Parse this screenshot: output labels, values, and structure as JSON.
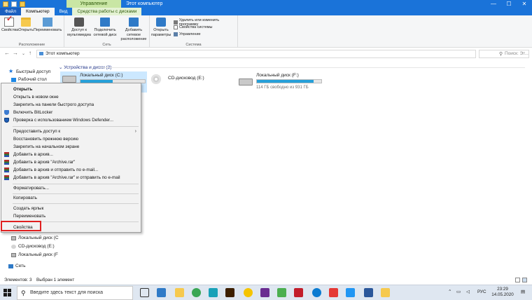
{
  "window": {
    "title": "Этот компьютер",
    "ribbon_context_header": "Управление",
    "controls": [
      "—",
      "☐",
      "✕"
    ]
  },
  "tabs": [
    {
      "label": "Файл"
    },
    {
      "label": "Компьютер"
    },
    {
      "label": "Вид"
    },
    {
      "label": "Средства работы с дисками"
    }
  ],
  "ribbon": {
    "groups": [
      {
        "label": "Расположение",
        "buttons": [
          "Свойства",
          "Открыть",
          "Переименовать"
        ]
      },
      {
        "label": "Сеть",
        "buttons": [
          "Доступ к мультимедиа",
          "Подключить сетевой диск",
          "Добавить сетевое расположение"
        ]
      },
      {
        "label": "Система",
        "buttons": [
          "Открыть параметры"
        ],
        "small_items": [
          "Удалить или изменить программу",
          "Свойства системы",
          "Управление"
        ]
      }
    ]
  },
  "address": {
    "path": "Этот компьютер",
    "search_placeholder": "Поиск: Эт..."
  },
  "nav": {
    "items": [
      "Быстрый доступ",
      "Рабочий стол",
      "Локальный диск (C",
      "CD-дисковод (E:)",
      "Локальный диск (F",
      "Сеть"
    ]
  },
  "content": {
    "group_header": "Устройства и диски (3)",
    "drives": [
      {
        "name": "Локальный диск (C:)",
        "free": "",
        "fill": 0.5
      },
      {
        "name": "CD-дисковод (E:)",
        "free": "",
        "fill": 0
      },
      {
        "name": "Локальный диск (F:)",
        "free": "114 ГБ свободно из 931 ГБ",
        "fill": 0.88
      }
    ]
  },
  "context_menu": {
    "items": [
      {
        "label": "Открыть",
        "bold": true
      },
      {
        "label": "Открыть в новом окне"
      },
      {
        "label": "Закрепить на панели быстрого доступа"
      },
      {
        "label": "Включить BitLocker",
        "icon": "shield-icon"
      },
      {
        "label": "Проверка с использованием Windows Defender...",
        "icon": "defender-icon"
      },
      {
        "label": "Предоставить доступ к",
        "submenu": true
      },
      {
        "label": "Восстановить прежнюю версию"
      },
      {
        "label": "Закрепить на начальном экране"
      },
      {
        "label": "Добавить в архив...",
        "icon": "winrar-icon"
      },
      {
        "label": "Добавить в архив \"Archive.rar\"",
        "icon": "winrar-icon"
      },
      {
        "label": "Добавить в архив и отправить по e-mail...",
        "icon": "winrar-icon"
      },
      {
        "label": "Добавить в архив \"Archive.rar\" и отправить по e-mail",
        "icon": "winrar-icon"
      },
      {
        "label": "Форматировать..."
      },
      {
        "label": "Копировать"
      },
      {
        "label": "Создать ярлык"
      },
      {
        "label": "Переименовать"
      },
      {
        "label": "Свойства"
      }
    ]
  },
  "status": {
    "items_count": "Элементов: 3",
    "selected": "Выбран 1 элемент"
  },
  "taskbar": {
    "search_placeholder": "Введите здесь текст для поиска",
    "language": "РУС",
    "time": "23:29",
    "date": "14.05.2020"
  },
  "colors": {
    "accent": "#1a73d9",
    "selection": "#cce8ff",
    "drive_bar": "#26a0da",
    "highlight": "#e02020"
  }
}
